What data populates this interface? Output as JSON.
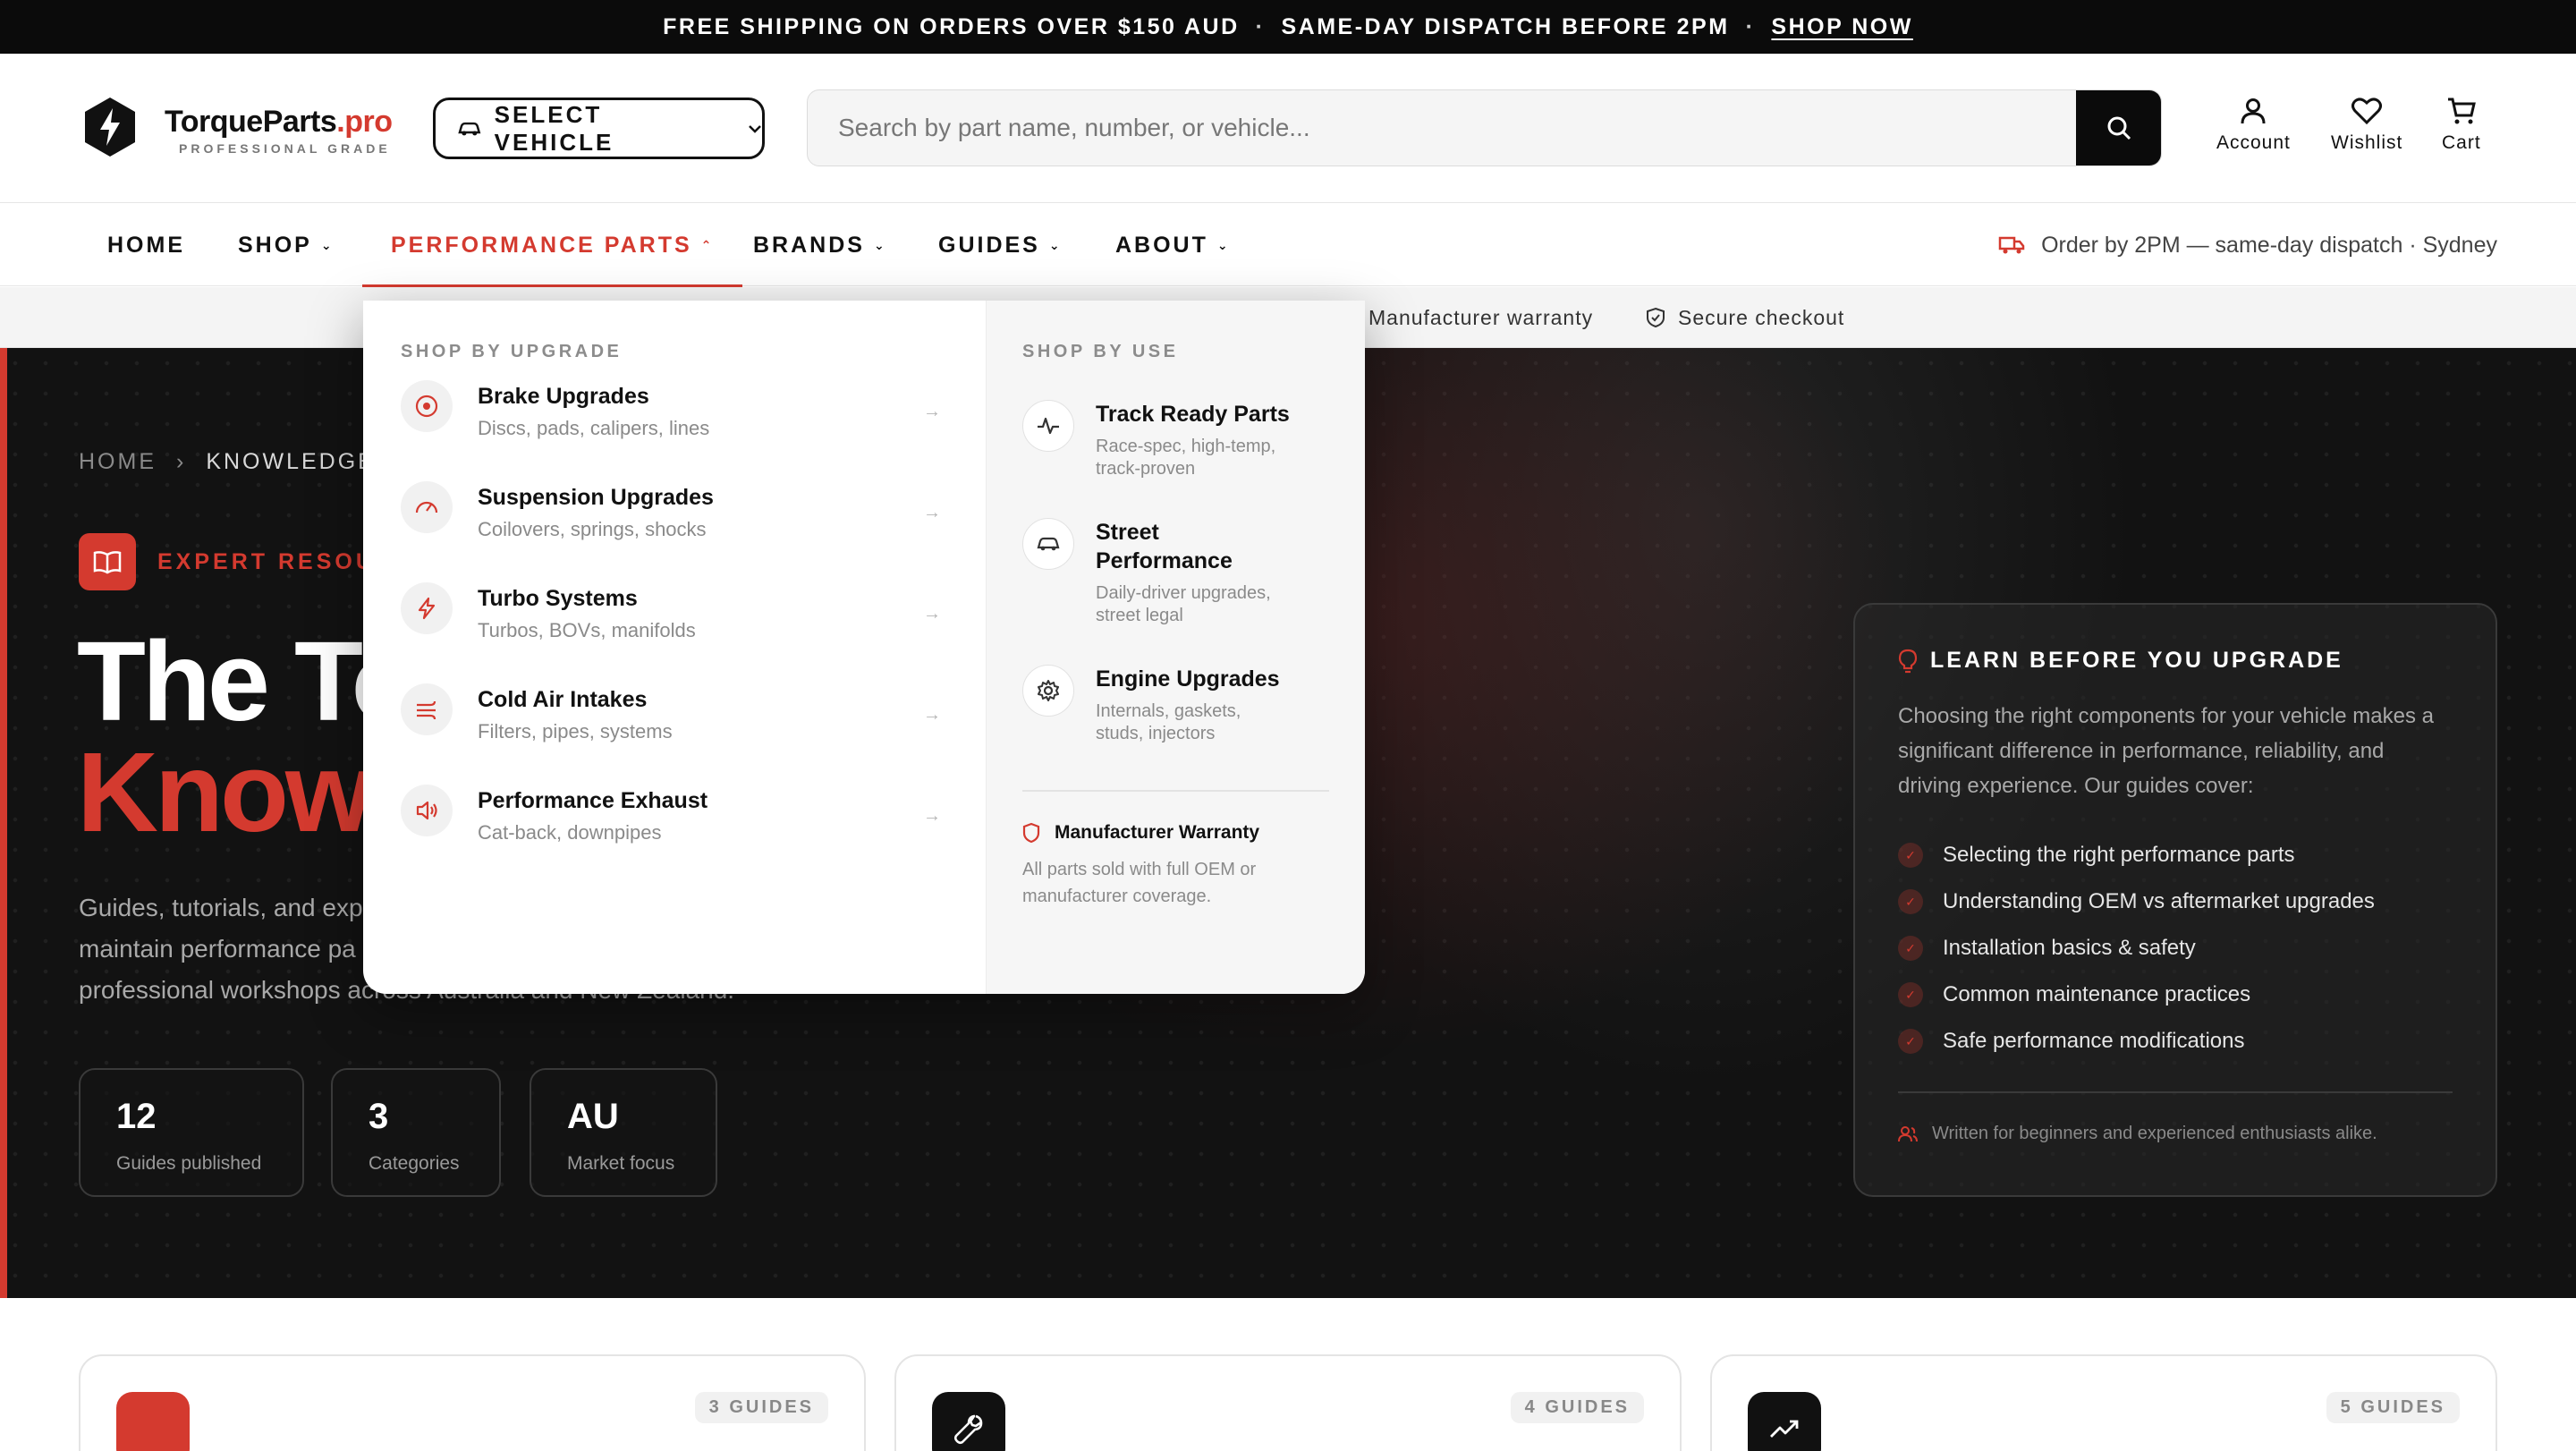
{
  "announcement": {
    "text1": "FREE SHIPPING ON ORDERS OVER $150 AUD",
    "separator": "·",
    "text2": "SAME-DAY DISPATCH BEFORE 2PM",
    "link": "SHOP NOW"
  },
  "brand": {
    "name": "TorqueParts",
    "tld": ".pro",
    "tagline": "PROFESSIONAL GRADE",
    "icon": "lightning-hexagon-icon"
  },
  "header": {
    "vehicle_button": "SELECT VEHICLE",
    "search_placeholder": "Search by part name, number, or vehicle...",
    "account": "Account",
    "wishlist": "Wishlist",
    "cart": "Cart"
  },
  "nav": {
    "items": [
      {
        "label": "HOME",
        "has_caret": false
      },
      {
        "label": "SHOP",
        "has_caret": true
      },
      {
        "label": "PERFORMANCE PARTS",
        "has_caret": true,
        "active": true
      },
      {
        "label": "BRANDS",
        "has_caret": true
      },
      {
        "label": "GUIDES",
        "has_caret": true
      },
      {
        "label": "ABOUT",
        "has_caret": true
      }
    ],
    "caret_down": "⌄",
    "caret_up": "⌃",
    "dispatch": "Order by 2PM — same-day dispatch · Sydney"
  },
  "trust": {
    "warranty": "Manufacturer warranty",
    "secure": "Secure checkout"
  },
  "hero": {
    "breadcrumb": [
      "HOME",
      "KNOWLEDGE"
    ],
    "crumb_sep": "›",
    "eyebrow": "EXPERT RESOUR",
    "title_line1": "The To",
    "title_line2": "Know",
    "subtitle": "Guides, tutorials, and exp... maintain performance pa... professional workshops across Australia and New Zealand.",
    "sub1": "Guides, tutorials, and exp",
    "sub2": "maintain performance pa",
    "sub3": "professional workshops across Australia and New Zealand.",
    "stats": [
      {
        "value": "12",
        "label": "Guides published"
      },
      {
        "value": "3",
        "label": "Categories"
      },
      {
        "value": "AU",
        "label": "Market focus"
      }
    ]
  },
  "learn": {
    "title": "LEARN BEFORE YOU UPGRADE",
    "body": "Choosing the right components for your vehicle makes a significant difference in performance, reliability, and driving experience. Our guides cover:",
    "items": [
      "Selecting the right performance parts",
      "Understanding OEM vs aftermarket upgrades",
      "Installation basics & safety",
      "Common maintenance practices",
      "Safe performance modifications"
    ],
    "footer": "Written for beginners and experienced enthusiasts alike."
  },
  "mega_menu": {
    "left_heading": "SHOP BY UPGRADE",
    "upgrades": [
      {
        "title": "Brake Upgrades",
        "desc": "Discs, pads, calipers, lines",
        "icon": "brake-disc-icon"
      },
      {
        "title": "Suspension Upgrades",
        "desc": "Coilovers, springs, shocks",
        "icon": "gauge-icon"
      },
      {
        "title": "Turbo Systems",
        "desc": "Turbos, BOVs, manifolds",
        "icon": "lightning-icon"
      },
      {
        "title": "Cold Air Intakes",
        "desc": "Filters, pipes, systems",
        "icon": "airflow-icon"
      },
      {
        "title": "Performance Exhaust",
        "desc": "Cat-back, downpipes",
        "icon": "speaker-icon"
      }
    ],
    "arrow": "→",
    "right_heading": "SHOP BY USE",
    "uses": [
      {
        "title": "Track Ready Parts",
        "desc": "Race-spec, high-temp, track-proven",
        "icon": "pulse-icon"
      },
      {
        "title": "Street Performance",
        "desc": "Daily-driver upgrades, street legal",
        "icon": "car-icon"
      },
      {
        "title": "Engine Upgrades",
        "desc": "Internals, gaskets, studs, injectors",
        "icon": "gear-icon"
      }
    ],
    "warranty_title": "Manufacturer Warranty",
    "warranty_desc": "All parts sold with full OEM or manufacturer coverage."
  },
  "cards": [
    {
      "count": "3 GUIDES",
      "icon": "category-icon",
      "color": "#d43a2f"
    },
    {
      "count": "4 GUIDES",
      "icon": "wrench-icon",
      "color": "#111111"
    },
    {
      "count": "5 GUIDES",
      "icon": "trend-up-icon",
      "color": "#111111"
    }
  ],
  "colors": {
    "accent": "#d43a2f",
    "dark": "#0b0b0b"
  }
}
